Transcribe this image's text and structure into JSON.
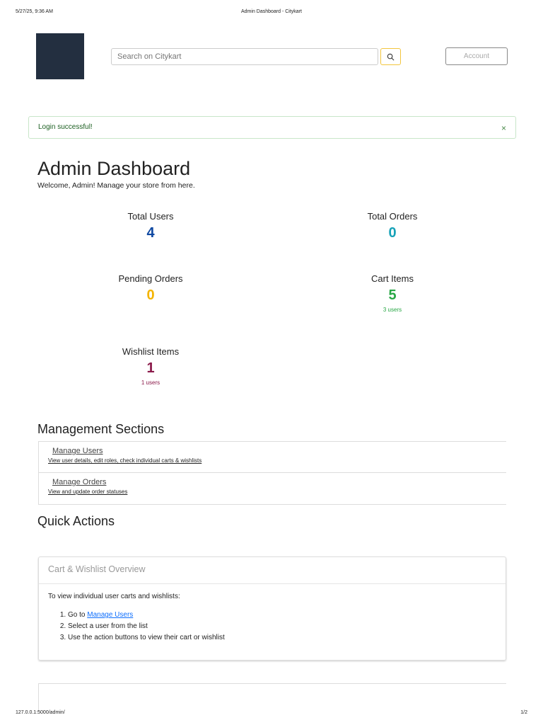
{
  "print_header": {
    "datetime": "5/27/25, 9:36 AM",
    "title": "Admin Dashboard - Citykart"
  },
  "header": {
    "search_placeholder": "Search on Citykart",
    "account_label": "Account"
  },
  "alert": {
    "message": "Login successful!",
    "close": "×"
  },
  "page": {
    "title": "Admin Dashboard",
    "welcome": "Welcome, Admin! Manage your store from here."
  },
  "stats": [
    {
      "label": "Total Users",
      "value": "4",
      "color": "#0d47a1"
    },
    {
      "label": "Total Orders",
      "value": "0",
      "color": "#17a2b8"
    },
    {
      "label": "Pending Orders",
      "value": "0",
      "color": "#f4b400"
    },
    {
      "label": "Cart Items",
      "value": "5",
      "sub": "3 users",
      "color": "#28a745"
    },
    {
      "label": "Wishlist Items",
      "value": "1",
      "sub": "1 users",
      "color": "#8b1a4a"
    }
  ],
  "management": {
    "title": "Management Sections",
    "items": [
      {
        "label": "Manage Users",
        "desc": "View user details, edit roles, check individual carts & wishlists"
      },
      {
        "label": "Manage Orders",
        "desc": "View and update order statuses"
      }
    ]
  },
  "quick_actions": {
    "title": "Quick Actions"
  },
  "overview": {
    "title": "Cart & Wishlist Overview",
    "intro": "To view individual user carts and wishlists:",
    "step1_prefix": "Go to ",
    "step1_link": "Manage Users",
    "step2": "Select a user from the list",
    "step3": "Use the action buttons to view their cart or wishlist"
  },
  "print_footer": {
    "url": "127.0.0.1:5000/admin/",
    "page": "1/2"
  }
}
